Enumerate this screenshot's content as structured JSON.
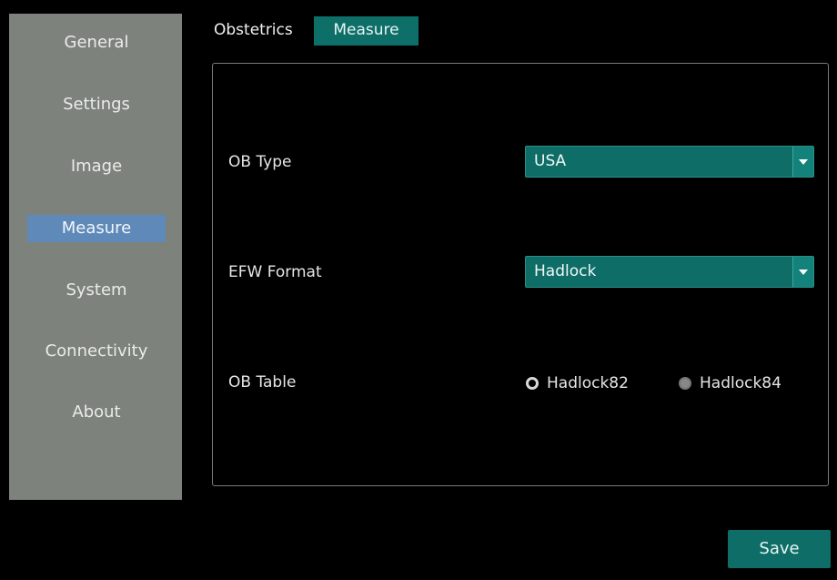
{
  "sidebar": {
    "items": [
      {
        "label": "General",
        "active": false
      },
      {
        "label": "Settings",
        "active": false
      },
      {
        "label": "Image",
        "active": false
      },
      {
        "label": "Measure",
        "active": true
      },
      {
        "label": "System",
        "active": false
      },
      {
        "label": "Connectivity",
        "active": false
      },
      {
        "label": "About",
        "active": false
      }
    ]
  },
  "tabs": {
    "items": [
      {
        "label": "Obstetrics",
        "active": false
      },
      {
        "label": "Measure",
        "active": true
      }
    ]
  },
  "form": {
    "ob_type": {
      "label": "OB Type",
      "value": "USA"
    },
    "efw_format": {
      "label": "EFW Format",
      "value": "Hadlock"
    },
    "ob_table": {
      "label": "OB Table",
      "options": [
        {
          "label": "Hadlock82",
          "selected": false
        },
        {
          "label": "Hadlock84",
          "selected": true
        }
      ]
    }
  },
  "footer": {
    "save_label": "Save"
  },
  "colors": {
    "accent": "#0e6d67",
    "sidebar_bg": "#7e827d",
    "nav_active": "#5e89b8",
    "background": "#000000"
  }
}
